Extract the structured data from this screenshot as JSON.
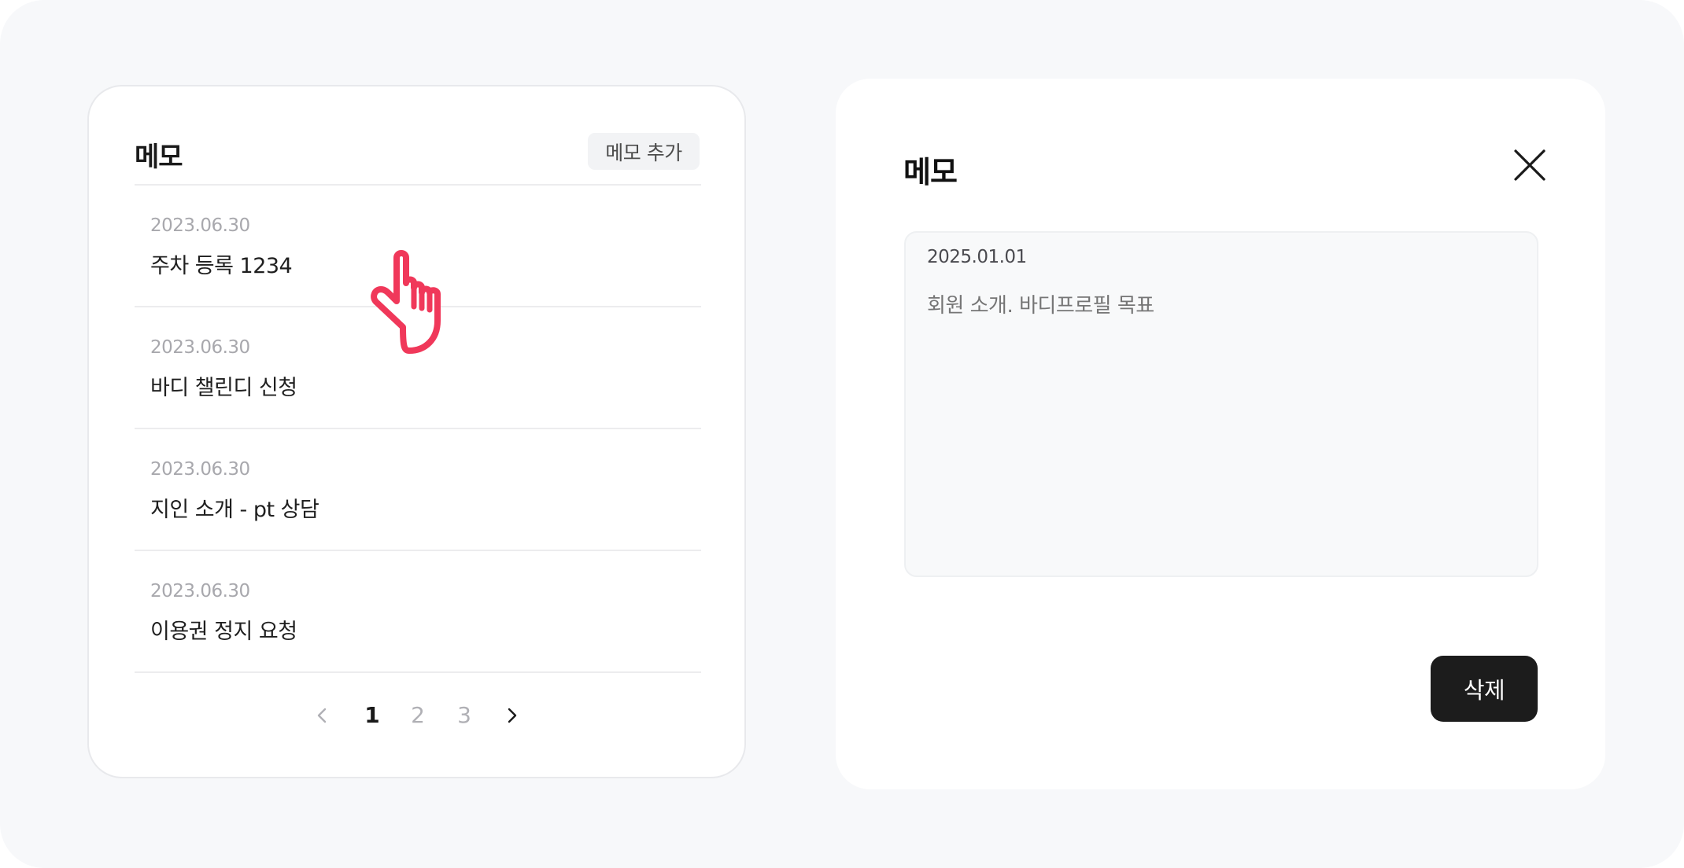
{
  "memo_list": {
    "title": "메모",
    "add_button_label": "메모 추가",
    "items": [
      {
        "date": "2023.06.30",
        "text": "주차 등록 1234"
      },
      {
        "date": "2023.06.30",
        "text": "바디 챌린디 신청"
      },
      {
        "date": "2023.06.30",
        "text": "지인 소개 - pt 상담"
      },
      {
        "date": "2023.06.30",
        "text": "이용권 정지 요청"
      }
    ],
    "pagination": {
      "pages": [
        "1",
        "2",
        "3"
      ],
      "current_page": "1",
      "prev_icon": "chevron-left-icon",
      "next_icon": "chevron-right-icon"
    }
  },
  "memo_detail": {
    "title": "메모",
    "close_icon": "close-icon",
    "date": "2025.01.01",
    "content_placeholder": "회원 소개. 바디프로필 목표",
    "delete_button_label": "삭제"
  },
  "cursor": {
    "icon": "hand-pointer-icon",
    "color": "#f0385a"
  },
  "colors": {
    "background": "#f7f8fa",
    "card": "#ffffff",
    "primary_button": "#1c1c1c",
    "muted_text": "#a8a8ad"
  }
}
